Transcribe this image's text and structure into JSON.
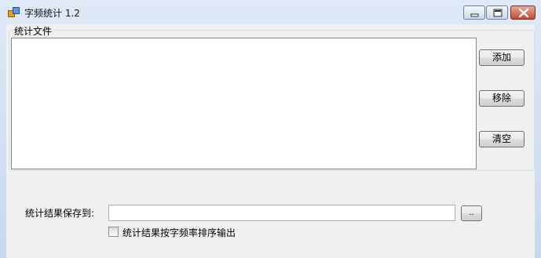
{
  "window": {
    "title": "字频统计 1.2",
    "icons": {
      "app": "app-icon",
      "minimize": "minimize-icon",
      "maximize": "maximize-icon",
      "close": "close-icon"
    }
  },
  "files_group": {
    "label": "统计文件",
    "files": [],
    "buttons": {
      "add": "添加",
      "remove": "移除",
      "clear": "清空"
    }
  },
  "output": {
    "save_label": "统计结果保存到:",
    "path_value": "",
    "browse_label": "..",
    "sort_checkbox_label": "统计结果按字频率排序输出",
    "sort_checked": false
  }
}
